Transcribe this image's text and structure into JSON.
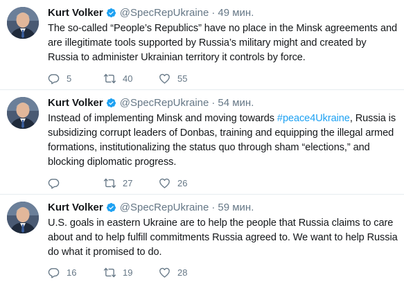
{
  "tweets": [
    {
      "author": "Kurt Volker",
      "handle": "@SpecRepUkraine",
      "time": "49 мин.",
      "text": [
        {
          "t": "The so-called “People’s Republics” have no place in the Minsk agreements and are illegitimate tools supported by Russia’s military might and created by Russia to administer Ukrainian territory it controls by force.",
          "tag": false
        }
      ],
      "replies": "5",
      "retweets": "40",
      "likes": "55"
    },
    {
      "author": "Kurt Volker",
      "handle": "@SpecRepUkraine",
      "time": "54 мин.",
      "text": [
        {
          "t": "Instead of implementing Minsk and moving towards ",
          "tag": false
        },
        {
          "t": "#peace4Ukraine",
          "tag": true
        },
        {
          "t": ", Russia is subsidizing corrupt leaders of Donbas, training and equipping the illegal armed formations, institutionalizing the status quo through sham “elections,” and blocking diplomatic progress.",
          "tag": false
        }
      ],
      "replies": "",
      "retweets": "27",
      "likes": "26"
    },
    {
      "author": "Kurt Volker",
      "handle": "@SpecRepUkraine",
      "time": "59 мин.",
      "text": [
        {
          "t": "U.S. goals  in eastern Ukraine are to help the people that Russia claims to care about and to help fulfill commitments Russia agreed to.  We want to help Russia do what it promised to do.",
          "tag": false
        }
      ],
      "replies": "16",
      "retweets": "19",
      "likes": "28"
    }
  ],
  "icons": {
    "verified": "verified-badge-icon",
    "reply": "reply-icon",
    "retweet": "retweet-icon",
    "like": "heart-icon"
  },
  "colors": {
    "name": "#14171a",
    "secondary": "#657786",
    "hashtag": "#1da1f2",
    "verified": "#1da1f2",
    "divider": "#e6ecf0"
  }
}
